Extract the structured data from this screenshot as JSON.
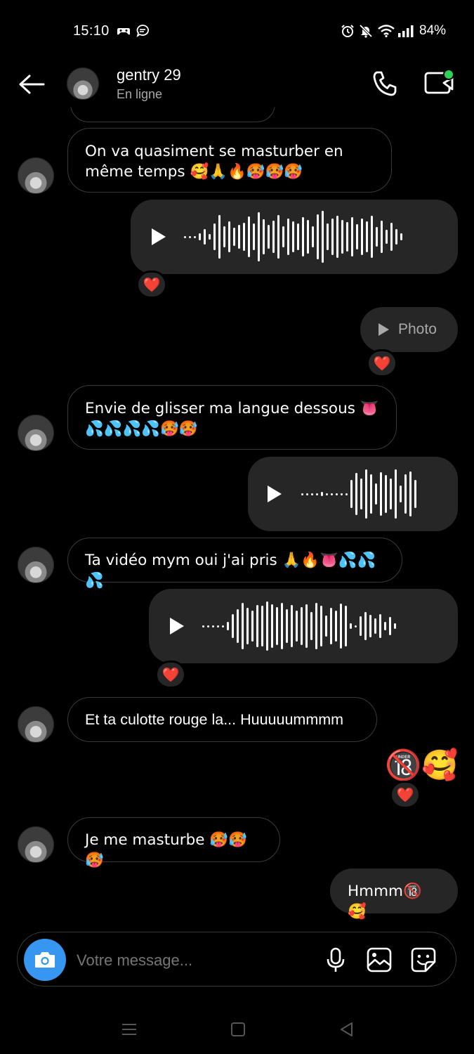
{
  "status_bar": {
    "time": "15:10",
    "battery": "84%",
    "left_icons": [
      "gamepad-icon",
      "chat-bubble-icon"
    ],
    "right_icons": [
      "alarm-icon",
      "bell-muted-icon",
      "wifi-icon",
      "signal-icon"
    ]
  },
  "header": {
    "name": "gentry 29",
    "status": "En ligne",
    "icons": [
      "back-arrow-icon",
      "phone-icon",
      "video-call-icon"
    ],
    "active_dot_color": "#30d158"
  },
  "messages": [
    {
      "id": "m1",
      "direction": "in",
      "type": "text",
      "text": "On va quasiment se masturber en même temps 🥰🙏🔥🥵🥵🥵"
    },
    {
      "id": "m2",
      "direction": "out",
      "type": "voice",
      "reaction": "❤️"
    },
    {
      "id": "m3",
      "direction": "out",
      "type": "photo",
      "label": "Photo",
      "reaction": "❤️"
    },
    {
      "id": "m4",
      "direction": "in",
      "type": "text",
      "text": "Envie de glisser ma langue dessous 👅💦💦💦💦🥵🥵"
    },
    {
      "id": "m5",
      "direction": "out",
      "type": "voice"
    },
    {
      "id": "m6",
      "direction": "in",
      "type": "text",
      "text": "Ta vidéo mym oui j'ai pris 🙏🔥👅💦💦💦"
    },
    {
      "id": "m7",
      "direction": "out",
      "type": "voice",
      "reaction": "❤️"
    },
    {
      "id": "m8",
      "direction": "in",
      "type": "text",
      "text": "Et ta culotte rouge la... Huuuuummmm"
    },
    {
      "id": "m9",
      "direction": "out",
      "type": "emoji",
      "text": "🔞🥰",
      "reaction": "❤️"
    },
    {
      "id": "m10",
      "direction": "in",
      "type": "text",
      "text": "Je me masturbe 🥵🥵🥵"
    },
    {
      "id": "m11",
      "direction": "out",
      "type": "text",
      "text": "Hmmm🔞🥰"
    }
  ],
  "composer": {
    "placeholder": "Votre message...",
    "camera_color": "#3797f0",
    "icons": [
      "camera-icon",
      "microphone-icon",
      "gallery-icon",
      "sticker-icon"
    ]
  },
  "nav_bar": {
    "icons": [
      "menu-icon",
      "home-icon",
      "back-icon"
    ]
  }
}
